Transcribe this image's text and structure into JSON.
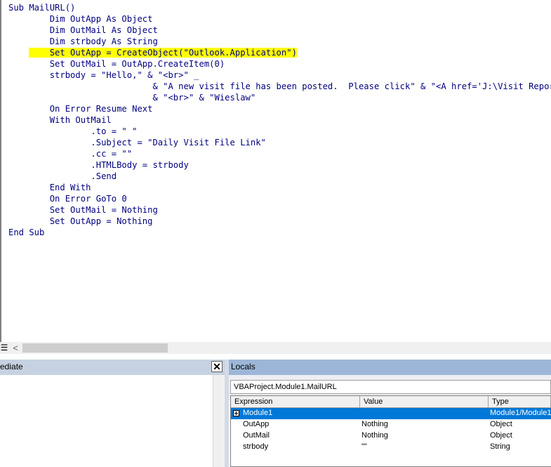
{
  "editor": {
    "code_lines": [
      "Sub MailURL()",
      "    Dim OutApp As Object",
      "    Dim OutMail As Object",
      "    Dim strbody As String",
      "    Set OutApp = CreateObject(\"Outlook.Application\")",
      "    Set OutMail = OutApp.CreateItem(0)",
      "    strbody = \"Hello,\" & \"<br>\" _",
      "              & \"A new visit file has been posted.  Please click\" & \"<A href='J:\\Visit Reports Co",
      "              & \"<br>\" & \"Wieslaw\"",
      "    On Error Resume Next",
      "    With OutMail",
      "        .to = \" \"",
      "        .Subject = \"Daily Visit File Link\"",
      "        .cc = \"\"",
      "        .HTMLBody = strbody",
      "        .Send",
      "    End With",
      "    On Error GoTo 0",
      "    Set OutMail = Nothing",
      "    Set OutApp = Nothing",
      "End Sub"
    ],
    "highlighted_line_index": 4,
    "highlight_color": "#ffff00",
    "code_color": "#000080"
  },
  "scrollbar": {
    "procedure_view_icon": "procedure-view-icon",
    "left_arrow": "<"
  },
  "immediate": {
    "title": "ediate",
    "close_glyph": "✕"
  },
  "locals": {
    "title": "Locals",
    "context": "VBAProject.Module1.MailURL",
    "columns": [
      "Expression",
      "Value",
      "Type"
    ],
    "rows": [
      {
        "expression": "Module1",
        "value": "",
        "type": "Module1/Module1",
        "expandable": true,
        "selected": true
      },
      {
        "expression": "OutApp",
        "value": "Nothing",
        "type": "Object",
        "expandable": false,
        "selected": false
      },
      {
        "expression": "OutMail",
        "value": "Nothing",
        "type": "Object",
        "expandable": false,
        "selected": false
      },
      {
        "expression": "strbody",
        "value": "\"\"",
        "type": "String",
        "expandable": false,
        "selected": false
      }
    ],
    "selection_color": "#0078d7"
  }
}
